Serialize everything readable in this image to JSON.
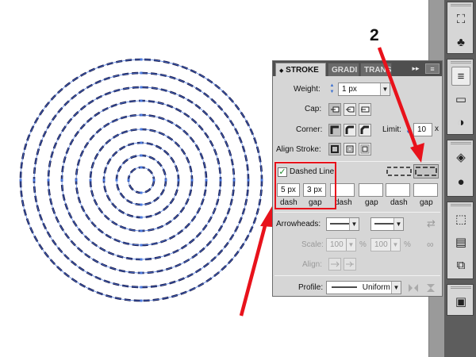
{
  "annotations": {
    "number_2": "2"
  },
  "stroke_panel": {
    "tabs": [
      {
        "label": "STROKE",
        "active": true
      },
      {
        "label": "GRADI",
        "active": false
      },
      {
        "label": "TRANS",
        "active": false
      }
    ],
    "collapse_glyph": "◆",
    "expand_glyph": "▸▸",
    "menu_glyph": "≡",
    "weight": {
      "label": "Weight:",
      "value": "1 px"
    },
    "cap": {
      "label": "Cap:"
    },
    "corner": {
      "label": "Corner:",
      "limit_label": "Limit:",
      "limit_value": "10",
      "limit_unit": "x"
    },
    "align_stroke": {
      "label": "Align Stroke:"
    },
    "dashed_line": {
      "label": "Dashed Line",
      "checked": true,
      "fields": [
        {
          "value": "5 px",
          "label": "dash"
        },
        {
          "value": "3 px",
          "label": "gap"
        },
        {
          "value": "",
          "label": "dash"
        },
        {
          "value": "",
          "label": "gap"
        },
        {
          "value": "",
          "label": "dash"
        },
        {
          "value": "",
          "label": "gap"
        }
      ]
    },
    "arrowheads": {
      "label": "Arrowheads:",
      "swap_glyph": "⇄"
    },
    "scale": {
      "label": "Scale:",
      "value1": "100",
      "value2": "100",
      "unit": "%",
      "link_glyph": "∞"
    },
    "align": {
      "label": "Align:"
    },
    "profile": {
      "label": "Profile:",
      "value": "Uniform"
    }
  },
  "dock": {
    "icons": [
      {
        "name": "symbol-sprayer-icon",
        "glyph": "⛶"
      },
      {
        "name": "symbols-club-icon",
        "glyph": "♣"
      },
      {
        "name": "stroke-panel-icon",
        "glyph": "≡",
        "active": true
      },
      {
        "name": "gradient-panel-icon",
        "glyph": "▭"
      },
      {
        "name": "transparency-panel-icon",
        "glyph": "◑"
      },
      {
        "name": "appearance-panel-icon",
        "glyph": "◈"
      },
      {
        "name": "graphic-styles-icon",
        "glyph": "●"
      },
      {
        "name": "transform-panel-icon",
        "glyph": "⬚"
      },
      {
        "name": "align-panel-icon",
        "glyph": "▤"
      },
      {
        "name": "pathfinder-panel-icon",
        "glyph": "⧉"
      },
      {
        "name": "image-trace-icon",
        "glyph": "▣"
      }
    ]
  }
}
